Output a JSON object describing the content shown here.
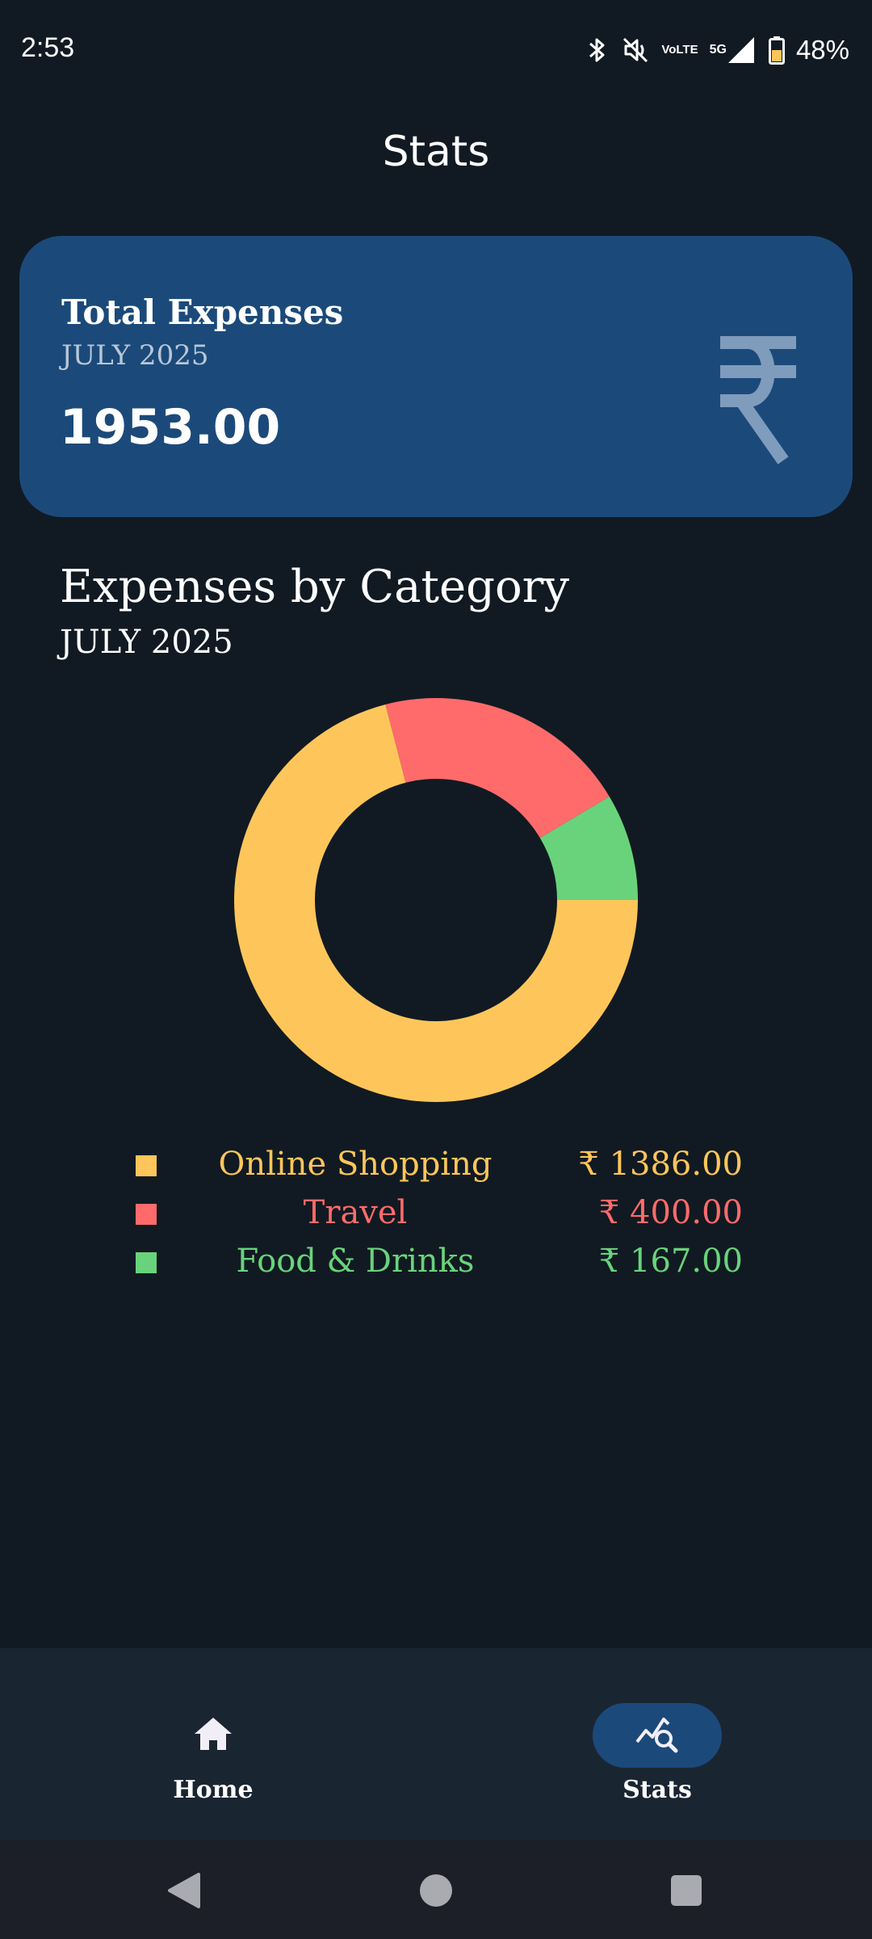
{
  "status_bar": {
    "time": "2:53",
    "volte_line1": "Vo",
    "volte_line2": "LTE",
    "network": "5G",
    "battery_percent": "48%"
  },
  "header": {
    "title": "Stats"
  },
  "total_card": {
    "title": "Total Expenses",
    "month": "JULY 2025",
    "amount": "1953.00",
    "icon": "rupee-icon"
  },
  "category_section": {
    "title": "Expenses by Category",
    "month": "JULY 2025"
  },
  "legend": [
    {
      "name": "Online Shopping",
      "value": "₹ 1386.00",
      "color": "#fec65a"
    },
    {
      "name": "Travel",
      "value": "₹ 400.00",
      "color": "#ff6b6b"
    },
    {
      "name": "Food & Drinks",
      "value": "₹ 167.00",
      "color": "#69d37b"
    }
  ],
  "chart_data": {
    "type": "pie",
    "categories": [
      "Online Shopping",
      "Travel",
      "Food & Drinks"
    ],
    "values": [
      1386,
      400,
      167
    ],
    "colors": [
      "#fec65a",
      "#ff6b6b",
      "#69d37b"
    ],
    "donut": true,
    "legend_placement": "bottom"
  },
  "bottom_nav": {
    "items": [
      {
        "label": "Home",
        "icon": "home-icon",
        "active": false
      },
      {
        "label": "Stats",
        "icon": "stats-search-icon",
        "active": true
      }
    ]
  },
  "colors": {
    "background": "#111a22",
    "card": "#1b4a7a",
    "nav_background": "#1a2532"
  }
}
